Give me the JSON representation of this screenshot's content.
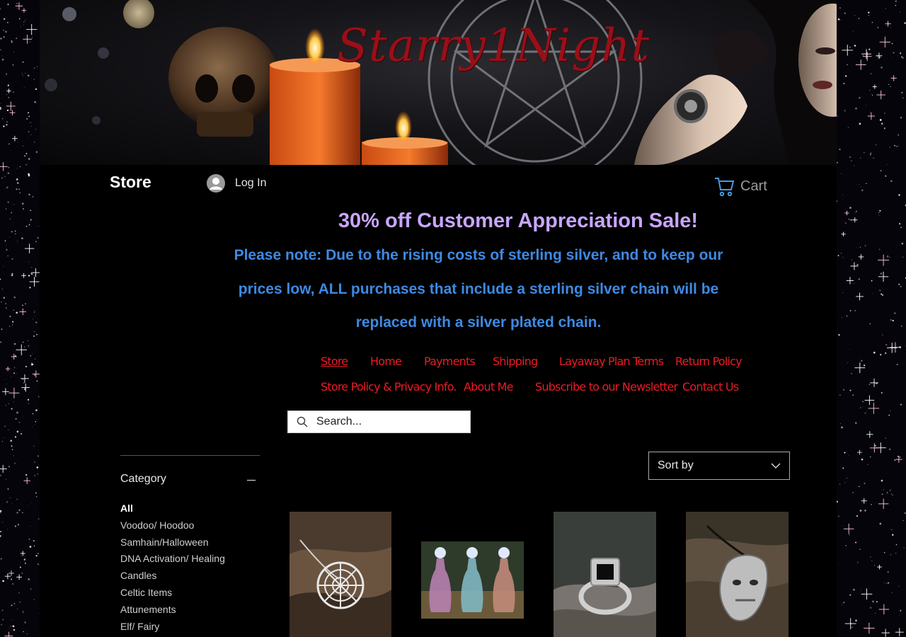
{
  "brand": {
    "logo_text": "Starry1Night"
  },
  "header": {
    "store_title": "Store",
    "login_label": "Log In",
    "cart_label": "Cart"
  },
  "announcement": {
    "sale": "30% off Customer Appreciation Sale!",
    "note_lines": [
      "Please note: Due to the rising costs of sterling silver, and to keep our",
      "prices low, ALL purchases that include a sterling silver chain will be",
      "replaced with a silver plated chain."
    ]
  },
  "nav": {
    "row1": [
      "Store",
      "Home",
      "Payments",
      "Shipping",
      "Layaway Plan Terms",
      "Return Policy"
    ],
    "row2": [
      "Store Policy & Privacy Info.",
      "About Me",
      "Subscribe to our Newsletter",
      "Contact Us"
    ],
    "active": "Store"
  },
  "search": {
    "placeholder": "Search..."
  },
  "filter": {
    "title": "Category",
    "items": [
      "All",
      "Voodoo/ Hoodoo",
      "Samhain/Halloween",
      "DNA Activation/ Healing",
      "Candles",
      "Celtic Items",
      "Attunements",
      "Elf/ Fairy"
    ],
    "selected": "All"
  },
  "sort": {
    "label": "Sort by"
  },
  "products": [
    {
      "name": "spiderweb-pendant-image",
      "icon": "spiderweb-pendant"
    },
    {
      "name": "potion-bottles-image",
      "icon": "potion-bottles"
    },
    {
      "name": "black-onyx-ring-image",
      "icon": "silver-ring"
    },
    {
      "name": "dragon-pendant-image",
      "icon": "dragon-pendant"
    }
  ],
  "colors": {
    "page_bg": "#000000",
    "sale_text": "#c8a6ff",
    "note_text": "#3e8ae3",
    "nav_link": "#ee1b24",
    "brand_red": "#9a0f18"
  }
}
